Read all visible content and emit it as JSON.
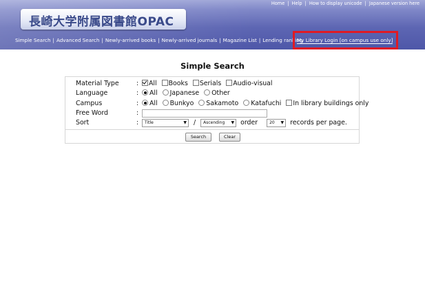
{
  "header": {
    "top_links": [
      "Home",
      "Help",
      "How to display unicode",
      "Japanese version here"
    ],
    "logo_text": "長崎大学附属図書館OPAC",
    "nav": [
      "Simple Search",
      "Advanced Search",
      "Newly-arrived books",
      "Newly-arrived journals",
      "Magazine List",
      "Lending ranking"
    ],
    "login": "My Library Login [on campus use only]",
    "highlight_color": "#e01a24"
  },
  "page_title": "Simple Search",
  "form": {
    "material_type": {
      "label": "Material Type",
      "options": [
        {
          "label": "All",
          "checked": true
        },
        {
          "label": "Books",
          "checked": false
        },
        {
          "label": "Serials",
          "checked": false
        },
        {
          "label": "Audio-visual",
          "checked": false
        }
      ]
    },
    "language": {
      "label": "Language",
      "options": [
        {
          "label": "All",
          "selected": true
        },
        {
          "label": "Japanese",
          "selected": false
        },
        {
          "label": "Other",
          "selected": false
        }
      ]
    },
    "campus": {
      "label": "Campus",
      "options": [
        {
          "label": "All",
          "selected": true
        },
        {
          "label": "Bunkyo",
          "selected": false
        },
        {
          "label": "Sakamoto",
          "selected": false
        },
        {
          "label": "Katafuchi",
          "selected": false
        }
      ],
      "in_library": "In library buildings only"
    },
    "free_word": {
      "label": "Free Word",
      "value": ""
    },
    "sort": {
      "label": "Sort",
      "field": "Title",
      "slash": "/",
      "direction": "Ascending",
      "order_text": "order",
      "count": "20",
      "records_text": "records per page."
    },
    "colon": ":"
  },
  "buttons": {
    "search": "Search",
    "clear": "Clear"
  }
}
